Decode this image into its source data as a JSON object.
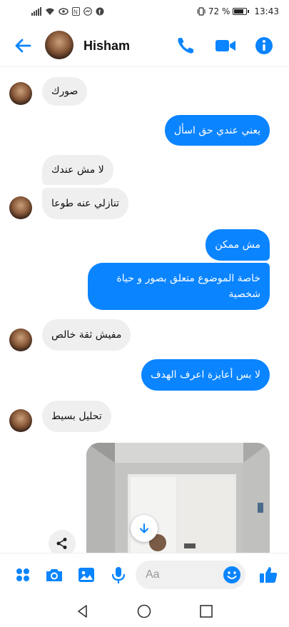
{
  "status_bar": {
    "battery_text": "72 %",
    "battery_level": 0.72,
    "time": "13:43"
  },
  "header": {
    "contact_name": "Hisham",
    "icons": [
      "back-arrow-icon",
      "phone-icon",
      "video-icon",
      "info-icon"
    ]
  },
  "messages": [
    {
      "side": "in",
      "text": "صورك"
    },
    {
      "side": "out",
      "text": "يعني عندي حق اسأل"
    },
    {
      "side": "in",
      "text": "لا مش عندك"
    },
    {
      "side": "in",
      "text": "تنازلي عنه طوعا"
    },
    {
      "side": "out",
      "text": "مش ممكن"
    },
    {
      "side": "out",
      "text": "خاصة الموضوع متعلق بصور و حياة شخصية"
    },
    {
      "side": "in",
      "text": "مفيش ثقة خالص"
    },
    {
      "side": "out",
      "text": "لا بس أعايزة اعرف الهدف"
    },
    {
      "side": "in",
      "text": "تحليل بسيط"
    }
  ],
  "composer": {
    "placeholder": "Aa",
    "icons": [
      "apps-icon",
      "camera-icon",
      "gallery-icon",
      "microphone-icon",
      "emoji-icon",
      "like-icon"
    ]
  },
  "colors": {
    "accent": "#0a84ff",
    "incoming_bubble": "#efefef"
  }
}
